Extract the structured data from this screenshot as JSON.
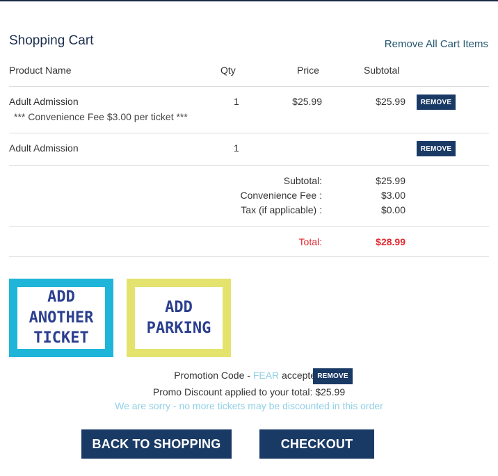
{
  "cart": {
    "title": "Shopping Cart",
    "remove_all_label": "Remove All Cart Items",
    "columns": {
      "product_name": "Product Name",
      "qty": "Qty",
      "price": "Price",
      "subtotal": "Subtotal"
    },
    "items": [
      {
        "name": "Adult Admission",
        "qty": "1",
        "price": "$25.99",
        "subtotal": "$25.99",
        "note": "*** Convenience Fee $3.00 per ticket ***",
        "remove_label": "REMOVE"
      },
      {
        "name": "Adult Admission",
        "qty": "1",
        "price": "",
        "subtotal": "",
        "note": "",
        "remove_label": "REMOVE"
      }
    ],
    "summary": {
      "subtotal_label": "Subtotal:",
      "subtotal_value": "$25.99",
      "fee_label": "Convenience Fee :",
      "fee_value": "$3.00",
      "tax_label": "Tax (if applicable) :",
      "tax_value": "$0.00",
      "total_label": "Total:",
      "total_value": "$28.99"
    }
  },
  "promos": {
    "add_ticket_label": "ADD ANOTHER TICKET",
    "add_parking_label": "ADD PARKING",
    "add_ticket_color": "#1eb5d8",
    "add_parking_color": "#e3e36e"
  },
  "promotion": {
    "prefix": "Promotion Code - ",
    "code": "FEAR",
    "suffix": " accepted.",
    "remove_label": "REMOVE",
    "discount_text": "Promo Discount applied to your total: $25.99",
    "notice": "We are sorry - no more tickets may be discounted in this order"
  },
  "actions": {
    "back_label": "BACK TO SHOPPING",
    "checkout_label": "CHECKOUT"
  },
  "colors": {
    "navy": "#1a3a66",
    "total_red": "#e0282e",
    "promo_light": "#8fd0e6"
  }
}
